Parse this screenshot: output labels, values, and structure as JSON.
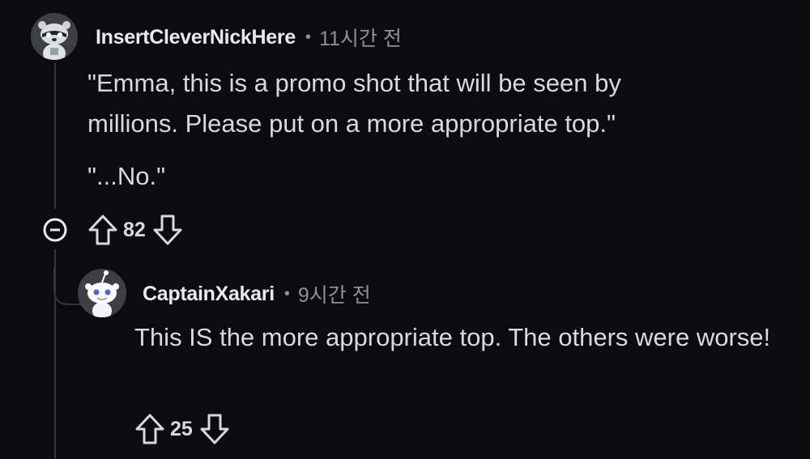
{
  "comments": [
    {
      "username": "InsertCleverNickHere",
      "separator": "•",
      "time": "11시간 전",
      "paragraphs": [
        "\"Emma, this is a promo shot that will be seen by millions. Please put on a more appropriate top.\"",
        "\"...No.\""
      ],
      "score": "82",
      "avatar_icon": "raccoon-snoo-avatar",
      "collapse_icon": "minus-circle-icon",
      "upvote_icon": "arrow-up-outline-icon",
      "downvote_icon": "arrow-down-outline-icon"
    },
    {
      "username": "CaptainXakari",
      "separator": "•",
      "time": "9시간 전",
      "paragraphs": [
        "This IS the more appropriate top. The others were worse!"
      ],
      "score": "25",
      "avatar_icon": "snoo-avatar",
      "upvote_icon": "arrow-up-outline-icon",
      "downvote_icon": "arrow-down-outline-icon"
    }
  ],
  "colors": {
    "background": "#0b0c0e",
    "text": "#d7dadc",
    "muted": "#8e9296",
    "thread_line": "#343536"
  }
}
